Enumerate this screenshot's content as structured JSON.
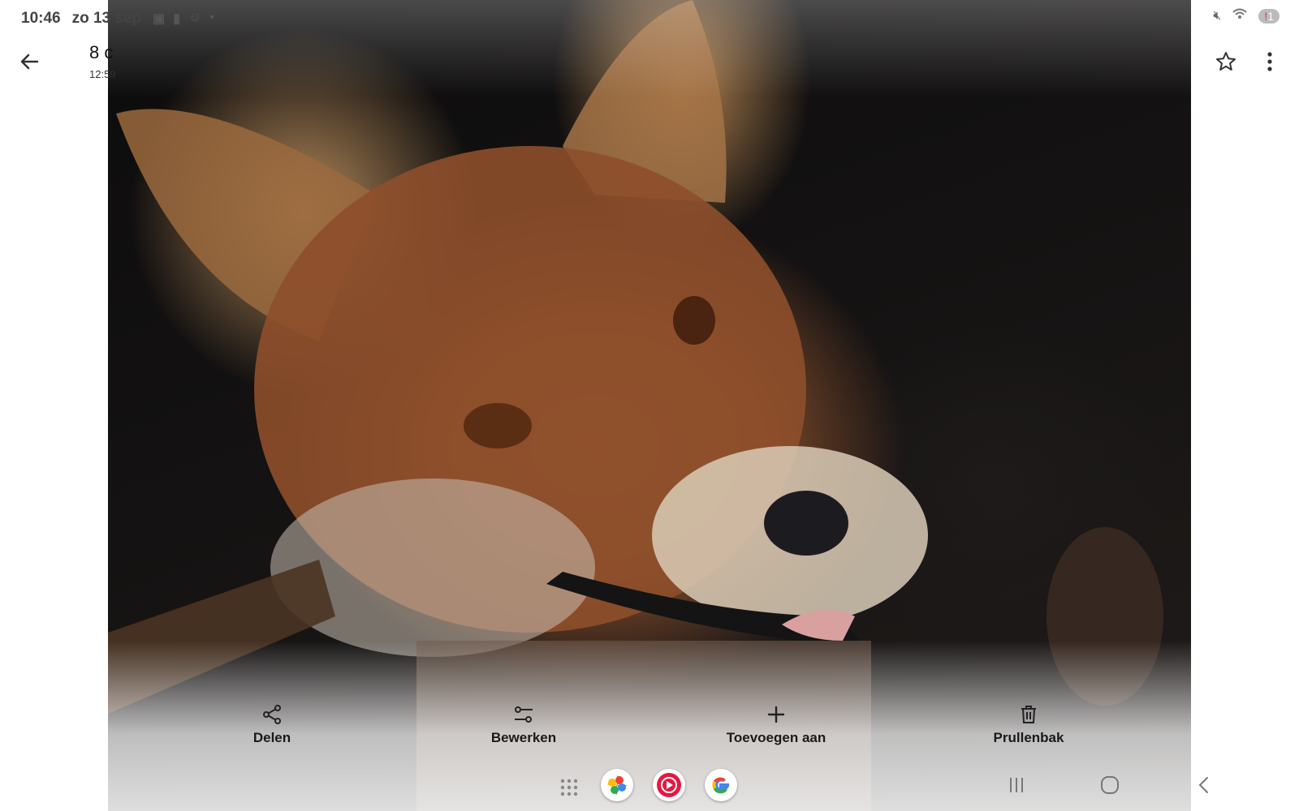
{
  "status_bar": {
    "time": "10:46",
    "date": "zo 13 sep",
    "badge_count": "1",
    "badge_alert": "!"
  },
  "header": {
    "title": "8 c",
    "subtitle": "12:59"
  },
  "actions": [
    {
      "label": "Delen",
      "icon": "share-icon"
    },
    {
      "label": "Bewerken",
      "icon": "edit-sliders-icon"
    },
    {
      "label": "Toevoegen aan",
      "icon": "plus-icon"
    },
    {
      "label": "Prullenbak",
      "icon": "trash-icon"
    }
  ],
  "dock": {
    "apps": [
      "app-drawer-icon",
      "photos-icon",
      "youtube-music-icon",
      "google-icon"
    ],
    "nav": [
      "recents-icon",
      "home-icon",
      "back-icon"
    ]
  },
  "colors": {
    "background": "#ffffff",
    "text": "#1a1a1a"
  }
}
